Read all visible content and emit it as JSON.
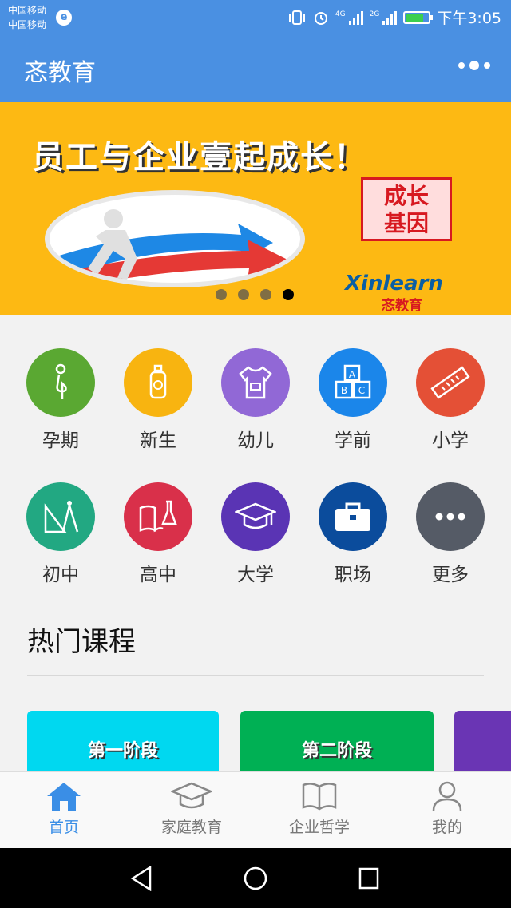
{
  "status": {
    "carrier1": "中国移动",
    "carrier2": "中国移动",
    "carrier_badge": "e",
    "net1": "4G",
    "net2": "2G",
    "time": "下午3:05"
  },
  "header": {
    "title": "忞教育",
    "menu_icon": "more-dots-icon"
  },
  "banner": {
    "slogan": "员工与企业壹起成长！",
    "stamp_line1": "成长",
    "stamp_line2": "基因",
    "brand_en": "Xinlearn",
    "brand_cn": "忞教育",
    "slides": 4,
    "active_slide": 4
  },
  "categories": [
    {
      "label": "孕期",
      "color": "#5aa832",
      "icon": "pregnant-icon"
    },
    {
      "label": "新生",
      "color": "#f8b410",
      "icon": "baby-bottle-icon"
    },
    {
      "label": "幼儿",
      "color": "#9168d6",
      "icon": "onesie-icon"
    },
    {
      "label": "学前",
      "color": "#1b86ea",
      "icon": "abc-blocks-icon"
    },
    {
      "label": "小学",
      "color": "#e45036",
      "icon": "ruler-icon"
    },
    {
      "label": "初中",
      "color": "#22a882",
      "icon": "compass-triangle-icon"
    },
    {
      "label": "高中",
      "color": "#d9304a",
      "icon": "book-flask-icon"
    },
    {
      "label": "大学",
      "color": "#5a34b4",
      "icon": "graduation-cap-icon"
    },
    {
      "label": "职场",
      "color": "#0b4c9c",
      "icon": "briefcase-icon"
    },
    {
      "label": "更多",
      "color": "#555b66",
      "icon": "more-icon"
    }
  ],
  "hot_courses": {
    "title": "热门课程",
    "items": [
      {
        "label": "第一阶段",
        "color": "#00d8f0"
      },
      {
        "label": "第二阶段",
        "color": "#00b054"
      },
      {
        "label": "",
        "color": "#6a35b4"
      }
    ]
  },
  "tabbar": {
    "items": [
      {
        "label": "首页",
        "icon": "home-icon",
        "active": true
      },
      {
        "label": "家庭教育",
        "icon": "graduation-cap-icon",
        "active": false
      },
      {
        "label": "企业哲学",
        "icon": "open-book-icon",
        "active": false
      },
      {
        "label": "我的",
        "icon": "person-icon",
        "active": false
      }
    ]
  },
  "theme": {
    "accent": "#4a90e2",
    "banner_bg": "#fdb913"
  }
}
